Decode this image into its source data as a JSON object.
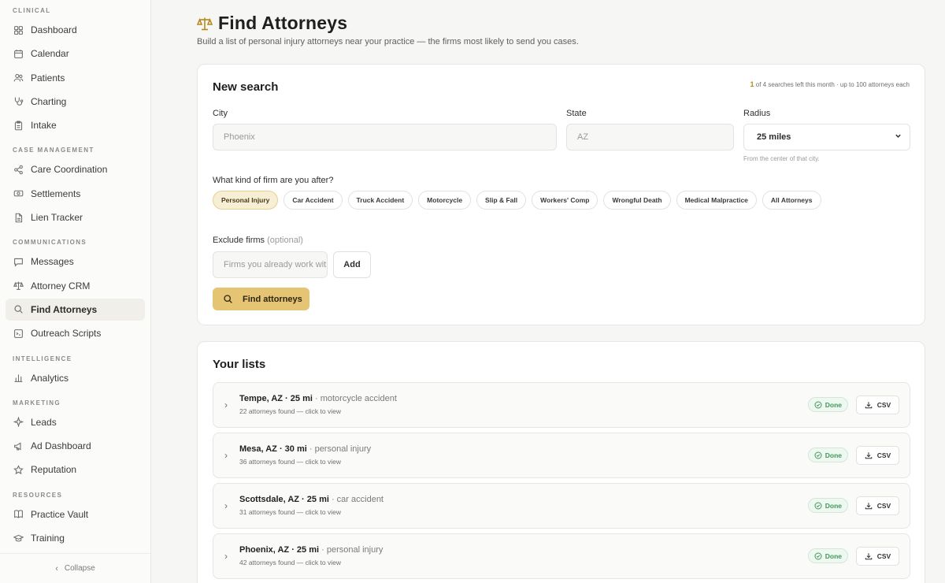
{
  "sidebar": {
    "sections": [
      {
        "label": "CLINICAL",
        "items": [
          {
            "label": "Dashboard",
            "icon": "grid-icon"
          },
          {
            "label": "Calendar",
            "icon": "calendar-icon"
          },
          {
            "label": "Patients",
            "icon": "users-icon"
          },
          {
            "label": "Charting",
            "icon": "stethoscope-icon"
          },
          {
            "label": "Intake",
            "icon": "clipboard-icon"
          }
        ]
      },
      {
        "label": "CASE MANAGEMENT",
        "items": [
          {
            "label": "Care Coordination",
            "icon": "share-icon"
          },
          {
            "label": "Settlements",
            "icon": "money-icon"
          },
          {
            "label": "Lien Tracker",
            "icon": "document-icon"
          }
        ]
      },
      {
        "label": "COMMUNICATIONS",
        "items": [
          {
            "label": "Messages",
            "icon": "message-icon"
          },
          {
            "label": "Attorney CRM",
            "icon": "scale-icon"
          },
          {
            "label": "Find Attorneys",
            "icon": "search-icon",
            "active": true
          },
          {
            "label": "Outreach Scripts",
            "icon": "script-icon"
          }
        ]
      },
      {
        "label": "INTELLIGENCE",
        "items": [
          {
            "label": "Analytics",
            "icon": "bar-chart-icon"
          }
        ]
      },
      {
        "label": "MARKETING",
        "items": [
          {
            "label": "Leads",
            "icon": "sparkle-icon"
          },
          {
            "label": "Ad Dashboard",
            "icon": "megaphone-icon"
          },
          {
            "label": "Reputation",
            "icon": "star-icon"
          }
        ]
      },
      {
        "label": "RESOURCES",
        "items": [
          {
            "label": "Practice Vault",
            "icon": "book-icon"
          },
          {
            "label": "Training",
            "icon": "cap-icon"
          }
        ]
      }
    ],
    "collapse_label": "Collapse"
  },
  "header": {
    "title": "Find Attorneys",
    "subtitle": "Build a list of personal injury attorneys near your practice — the firms most likely to send you cases."
  },
  "search": {
    "title": "New search",
    "quota_used": "1",
    "quota_text": "of 4 searches left this month · up to 100 attorneys each",
    "city_label": "City",
    "city_placeholder": "Phoenix",
    "state_label": "State",
    "state_placeholder": "AZ",
    "radius_label": "Radius",
    "radius_value": "25 miles",
    "radius_hint": "From the center of that city.",
    "firm_type_label": "What kind of firm are you after?",
    "firm_types": [
      {
        "label": "Personal Injury",
        "selected": true
      },
      {
        "label": "Car Accident",
        "selected": false
      },
      {
        "label": "Truck Accident",
        "selected": false
      },
      {
        "label": "Motorcycle",
        "selected": false
      },
      {
        "label": "Slip & Fall",
        "selected": false
      },
      {
        "label": "Workers' Comp",
        "selected": false
      },
      {
        "label": "Wrongful Death",
        "selected": false
      },
      {
        "label": "Medical Malpractice",
        "selected": false
      },
      {
        "label": "All Attorneys",
        "selected": false
      }
    ],
    "exclude_label": "Exclude firms",
    "exclude_optional": "(optional)",
    "exclude_placeholder": "Firms you already work with",
    "add_label": "Add",
    "submit_label": "Find attorneys"
  },
  "lists": {
    "title": "Your lists",
    "items": [
      {
        "title": "Tempe, AZ · 25 mi",
        "query": " · motorcycle accident",
        "subtitle": "22 attorneys found — click to view",
        "status": "Done",
        "csv": "CSV"
      },
      {
        "title": "Mesa, AZ · 30 mi",
        "query": " · personal injury",
        "subtitle": "36 attorneys found — click to view",
        "status": "Done",
        "csv": "CSV"
      },
      {
        "title": "Scottsdale, AZ · 25 mi",
        "query": " · car accident",
        "subtitle": "31 attorneys found — click to view",
        "status": "Done",
        "csv": "CSV"
      },
      {
        "title": "Phoenix, AZ · 25 mi",
        "query": " · personal injury",
        "subtitle": "42 attorneys found — click to view",
        "status": "Done",
        "csv": "CSV"
      }
    ]
  },
  "colors": {
    "accent": "#e5c473",
    "accent_text": "#b48a1f",
    "done_green": "#3f9a5b"
  }
}
